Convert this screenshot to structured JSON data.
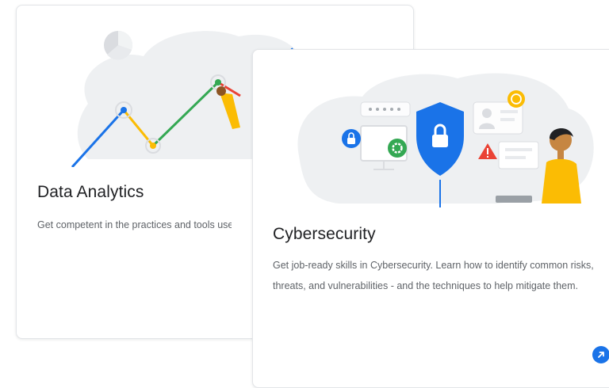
{
  "cards": [
    {
      "title": "Data Analytics",
      "description": "Get competent in the practices and tools used by a junior or associate data analyst in"
    },
    {
      "title": "Cybersecurity",
      "description": "Get job-ready skills in Cybersecurity. Learn how to identify common risks, threats, and vulnerabilities - and the techniques to help mitigate them."
    }
  ],
  "colors": {
    "blue": "#1a73e8",
    "yellow": "#fbbc04",
    "green": "#34a853",
    "red": "#ea4335",
    "illustration_bg": "#eef0f2"
  },
  "icons": {
    "pie_chart": "pie-chart-icon",
    "shield_lock": "shield-lock-icon",
    "user_lock": "user-lock-icon",
    "gear": "gear-icon",
    "warning": "warning-icon",
    "arrow": "arrow-up-right-icon"
  }
}
